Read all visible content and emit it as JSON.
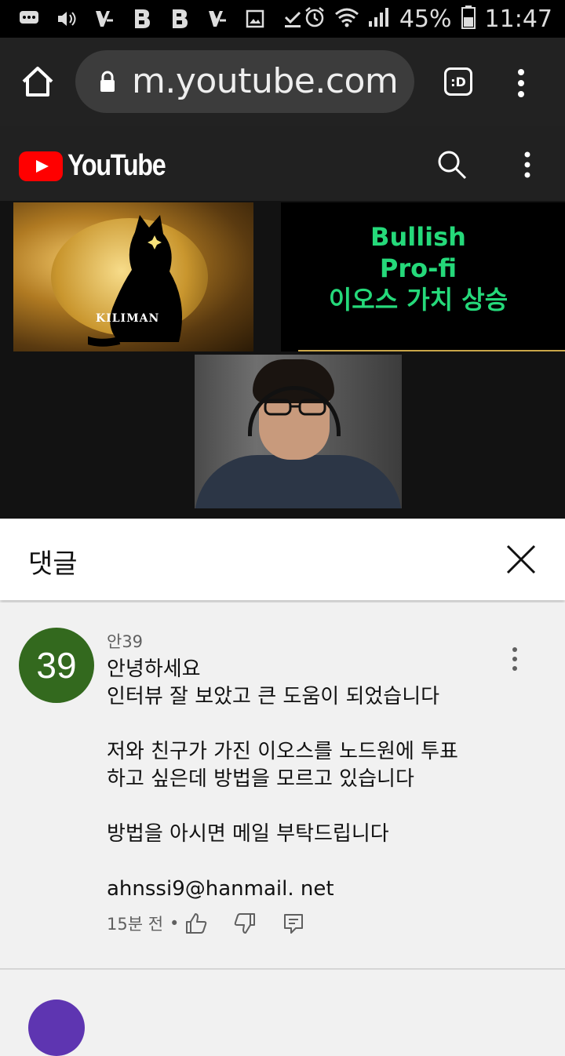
{
  "status_bar": {
    "battery": "45%",
    "time": "11:47",
    "icons": [
      "message-icon",
      "volume-icon",
      "notification-icon",
      "b-app-icon",
      "b-app-icon",
      "notification-icon",
      "image-icon",
      "download-done-icon",
      "alarm-icon",
      "wifi-icon",
      "signal-icon",
      "battery-icon"
    ]
  },
  "browser": {
    "url": "m.youtube.com",
    "tab_label": ":D"
  },
  "youtube": {
    "brand": "YouTube"
  },
  "video": {
    "thumb_label": "KILIMAN",
    "thumb_line1": "Bullish",
    "thumb_line2": "Pro-fi",
    "thumb_line3": "이오스 가치 상승"
  },
  "comments_panel": {
    "title": "댓글"
  },
  "comment": {
    "avatar_text": "39",
    "author": "안39",
    "lines": [
      "안녕하세요",
      "인터뷰 잘 보았고 큰 도움이 되었습니다",
      "",
      "저와 친구가 가진 이오스를 노드원에 투표",
      "하고 싶은데 방법을 모르고 있습니다",
      "",
      "방법을 아시면 메일 부탁드립니다",
      "",
      "ahnssi9@hanmail. net"
    ],
    "timestamp": "15분 전",
    "separator": "•"
  },
  "colors": {
    "avatar_bg": "#33691e",
    "youtube_red": "#ff0000",
    "thumb_text": "#25d97a"
  }
}
